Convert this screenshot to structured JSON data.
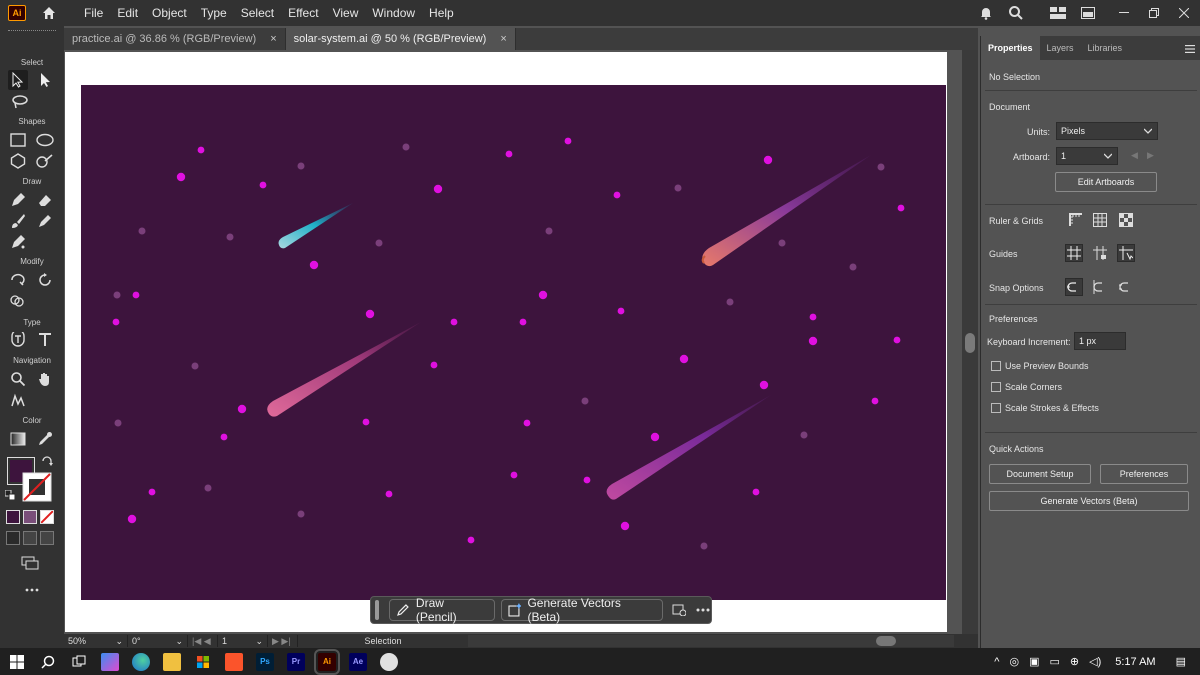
{
  "menubar": {
    "app_logo": "Ai",
    "items": [
      "File",
      "Edit",
      "Object",
      "Type",
      "Select",
      "Effect",
      "View",
      "Window",
      "Help"
    ]
  },
  "tabs": [
    {
      "label": "practice.ai @ 36.86 % (RGB/Preview)",
      "close": "×"
    },
    {
      "label": "solar-system.ai @ 50 % (RGB/Preview)",
      "close": "×"
    }
  ],
  "toolbar": {
    "sections": [
      "Select",
      "Shapes",
      "Draw",
      "Modify",
      "Type",
      "Navigation",
      "Color"
    ],
    "fill_color": "#3d143d"
  },
  "artboard": {
    "background": "#3d143d",
    "star_color": "#e010e0",
    "dim_star_color": "#7a3f7a"
  },
  "context_bar": {
    "draw_label": "Draw (Pencil)",
    "generate_label": "Generate Vectors (Beta)"
  },
  "statusbar": {
    "zoom": "50%",
    "rotation": "0°",
    "artboard": "1",
    "tool": "Selection"
  },
  "panel": {
    "tabs": [
      "Properties",
      "Layers",
      "Libraries"
    ],
    "selection": "No Selection",
    "document_title": "Document",
    "units_label": "Units:",
    "units_value": "Pixels",
    "artboard_label": "Artboard:",
    "artboard_value": "1",
    "edit_artboards": "Edit Artboards",
    "ruler_grids": "Ruler & Grids",
    "guides": "Guides",
    "snap_options": "Snap Options",
    "preferences_title": "Preferences",
    "keyboard_increment_label": "Keyboard Increment:",
    "keyboard_increment_value": "1 px",
    "use_preview_bounds": "Use Preview Bounds",
    "scale_corners": "Scale Corners",
    "scale_strokes": "Scale Strokes & Effects",
    "quick_actions": "Quick Actions",
    "document_setup": "Document Setup",
    "preferences_button": "Preferences",
    "generate_vectors": "Generate Vectors (Beta)"
  },
  "windows_taskbar": {
    "time": "5:17 AM",
    "apps": [
      "Ps",
      "Pr",
      "Ai",
      "Ae"
    ]
  }
}
